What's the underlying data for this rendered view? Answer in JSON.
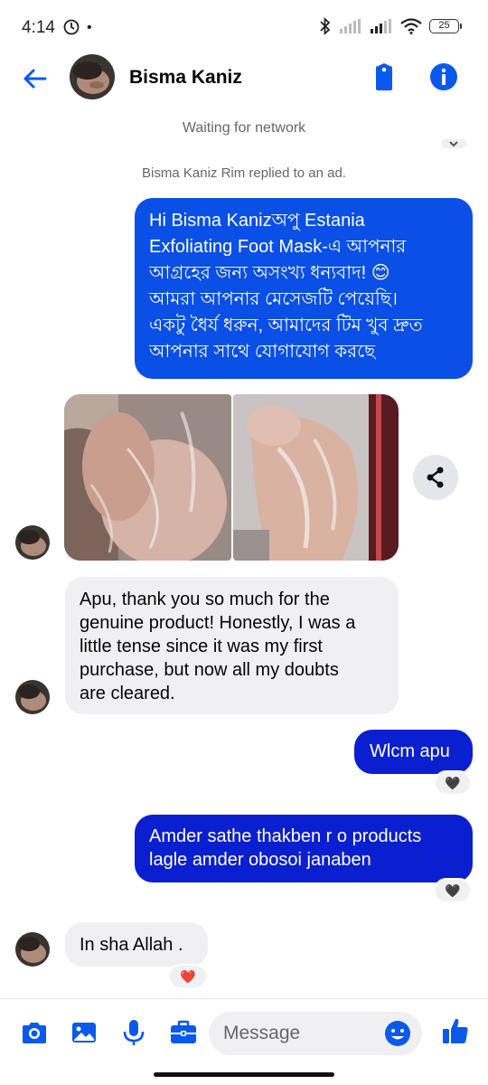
{
  "status_bar": {
    "time": "4:14",
    "battery": "25",
    "icons": [
      "clock-icon",
      "bluetooth-icon",
      "signal-icon",
      "wifi-icon",
      "battery-icon"
    ]
  },
  "header": {
    "contact_name": "Bisma Kaniz",
    "icons": [
      "back-arrow-icon",
      "tag-icon",
      "info-icon"
    ]
  },
  "notices": {
    "network": "Waiting for network",
    "replied": "Bisma Kaniz Rim replied to an ad."
  },
  "messages": [
    {
      "direction": "outgoing",
      "lines": [
        "Hi Bisma Kanizঅপু Estania",
        "Exfoliating Foot Mask-এ আপনার",
        "আগ্রহের জন্য অসংখ্য ধন্যবাদ! 😊",
        "আমরা আপনার মেসেজটি পেয়েছি।",
        "একটু ধৈর্য ধরুন, আমাদের টিম খুব দ্রুত",
        "আপনার সাথে যোগাযোগ করছে"
      ]
    },
    {
      "direction": "incoming",
      "attachment": "two foot photos"
    },
    {
      "direction": "incoming",
      "lines": [
        "Apu, thank you so much for the",
        "genuine product! Honestly, I was a",
        "little tense since it was my first",
        "purchase, but now all my doubts",
        "are cleared."
      ]
    },
    {
      "direction": "outgoing",
      "text": "Wlcm apu",
      "reaction": "🖤"
    },
    {
      "direction": "outgoing",
      "lines": [
        "Amder sathe thakben r o products",
        "lagle amder obosoi janaben"
      ],
      "reaction": "🖤"
    },
    {
      "direction": "incoming",
      "text": "In sha Allah .",
      "reaction": "❤️"
    }
  ],
  "composer": {
    "placeholder": "Message",
    "icons": [
      "camera-icon",
      "gallery-icon",
      "microphone-icon",
      "briefcase-icon",
      "emoji-icon",
      "like-icon"
    ]
  },
  "colors": {
    "accent": "#0a4fe6",
    "outgoing_dark": "#0a1fd0",
    "incoming_bg": "#f0f0f2"
  }
}
